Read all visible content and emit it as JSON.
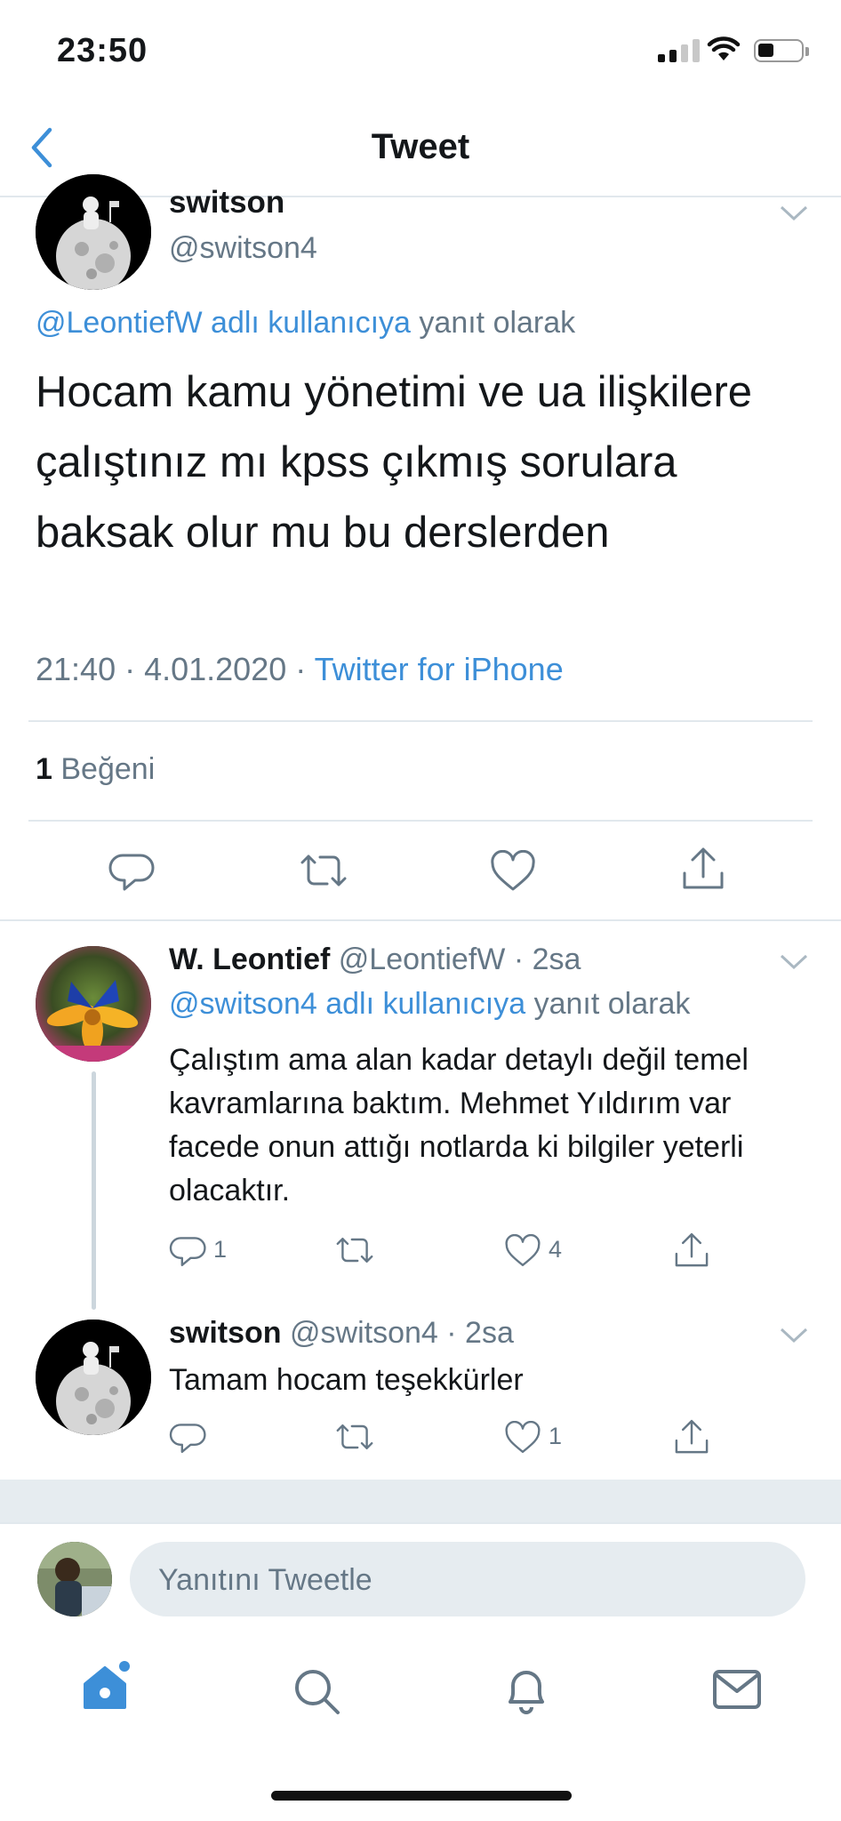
{
  "status_bar": {
    "time": "23:50"
  },
  "nav": {
    "title": "Tweet"
  },
  "main_tweet": {
    "name": "switson",
    "handle": "@switson4",
    "reply_to_link": "@LeontiefW adlı kullanıcıya",
    "reply_to_suffix": "yanıt olarak",
    "text": "Hocam kamu yönetimi ve ua ilişkilere çalıştınız mı kpss çıkmış sorulara baksak olur mu bu derslerden",
    "time": "21:40",
    "date": "4.01.2020",
    "source": "Twitter for iPhone",
    "likes_count": "1",
    "likes_label": "Beğeni"
  },
  "replies": [
    {
      "name": "W. Leontief",
      "handle": "@LeontiefW",
      "age": "2sa",
      "reply_to_link": "@switson4 adlı kullanıcıya",
      "reply_to_suffix": "yanıt olarak",
      "text": "Çalıştım ama alan kadar detaylı değil temel kavramlarına baktım. Mehmet Yıldırım var facede onun attığı notlarda ki bilgiler yeterli olacaktır.",
      "reply_count": "1",
      "like_count": "4"
    },
    {
      "name": "switson",
      "handle": "@switson4",
      "age": "2sa",
      "text": "Tamam hocam teşekkürler",
      "like_count": "1"
    }
  ],
  "composer": {
    "placeholder": "Yanıtını Tweetle"
  },
  "tab_bar": {
    "items": [
      "home-icon",
      "search-icon",
      "notifications-icon",
      "messages-icon"
    ]
  },
  "colors": {
    "link": "#3d8fd8",
    "secondary": "#657786",
    "divider": "#e1e8ed"
  }
}
